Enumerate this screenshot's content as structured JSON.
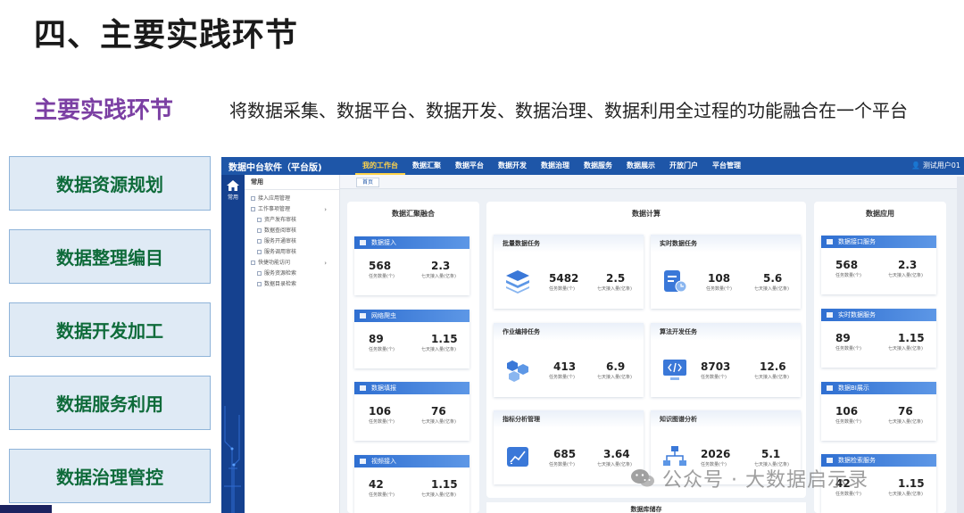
{
  "slide": {
    "heading": "四、主要实践环节",
    "subtitle": "主要实践环节",
    "description": "将数据采集、数据平台、数据开发、数据治理、数据利用全过程的功能融合在一个平台",
    "steps": [
      "数据资源规划",
      "数据整理编目",
      "数据开发加工",
      "数据服务利用",
      "数据治理管控"
    ],
    "watermark": "公众号 · 大数据启示录"
  },
  "app": {
    "title": "数据中台软件（平台版)",
    "nav": [
      "我的工作台",
      "数据汇聚",
      "数据平台",
      "数据开发",
      "数据治理",
      "数据服务",
      "数据展示",
      "开放门户",
      "平台管理"
    ],
    "user": "测试用户01",
    "sidebar_label": "常用",
    "menu_head": "常用",
    "menu": [
      {
        "label": "接入应用管理"
      },
      {
        "label": "工作事项管理",
        "chevron": "›"
      },
      {
        "label": "资产发布审核"
      },
      {
        "label": "数据查阅审核"
      },
      {
        "label": "服务开通审核"
      },
      {
        "label": "服务调用审核"
      },
      {
        "label": "快捷功能访问",
        "chevron": "›"
      },
      {
        "label": "服务资源检索"
      },
      {
        "label": "数据目录检索"
      }
    ],
    "tab": "首页",
    "left_col": {
      "title": "数据汇聚融合",
      "cards": [
        {
          "head": "数据接入",
          "v1": "568",
          "l1": "任务数量(个)",
          "v2": "2.3",
          "l2": "七天接入量(亿条)"
        },
        {
          "head": "网络爬虫",
          "v1": "89",
          "l1": "任务数量(个)",
          "v2": "1.15",
          "l2": "七天接入量(亿条)"
        },
        {
          "head": "数据填报",
          "v1": "106",
          "l1": "任务数量(个)",
          "v2": "76",
          "l2": "七天接入量(亿条)"
        },
        {
          "head": "视频接入",
          "v1": "42",
          "l1": "任务数量(个)",
          "v2": "1.15",
          "l2": "七天接入量(亿条)"
        }
      ]
    },
    "mid_col": {
      "title": "数据计算",
      "cards": [
        {
          "head": "批量数据任务",
          "v1": "5482",
          "l1": "任务数量(个)",
          "v2": "2.5",
          "l2": "七天接入量(亿条)"
        },
        {
          "head": "实时数据任务",
          "v1": "108",
          "l1": "任务数量(个)",
          "v2": "5.6",
          "l2": "七天接入量(亿条)"
        },
        {
          "head": "作业编排任务",
          "v1": "413",
          "l1": "任务数量(个)",
          "v2": "6.9",
          "l2": "七天接入量(亿条)"
        },
        {
          "head": "算法开发任务",
          "v1": "8703",
          "l1": "任务数量(个)",
          "v2": "12.6",
          "l2": "七天接入量(亿条)"
        },
        {
          "head": "指标分析管理",
          "v1": "685",
          "l1": "任务数量(个)",
          "v2": "3.64",
          "l2": "七天接入量(亿条)"
        },
        {
          "head": "知识图谱分析",
          "v1": "2026",
          "l1": "任务数量(个)",
          "v2": "5.1",
          "l2": "七天接入量(亿条)"
        }
      ],
      "bottom": "数据库储存"
    },
    "right_col": {
      "title": "数据应用",
      "cards": [
        {
          "head": "数据接口服务",
          "v1": "568",
          "l1": "任务数量(个)",
          "v2": "2.3",
          "l2": "七天接入量(亿条)"
        },
        {
          "head": "实时数据服务",
          "v1": "89",
          "l1": "任务数量(个)",
          "v2": "1.15",
          "l2": "七天接入量(亿条)"
        },
        {
          "head": "数据BI展示",
          "v1": "106",
          "l1": "任务数量(个)",
          "v2": "76",
          "l2": "七天接入量(亿条)"
        },
        {
          "head": "数据检索服务",
          "v1": "42",
          "l1": "任务数量(个)",
          "v2": "1.15",
          "l2": "七天接入量(亿条)"
        }
      ]
    }
  },
  "colors": {
    "accent_blue": "#1e56a8",
    "heading_purple": "#7b3fa3",
    "step_green": "#0e6b3a"
  }
}
